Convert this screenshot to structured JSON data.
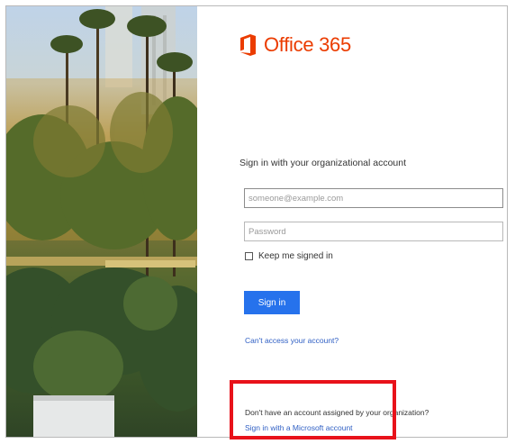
{
  "brand": {
    "name": "Office 365",
    "icon": "office-logo-icon",
    "color": "#eb3c00"
  },
  "login": {
    "heading": "Sign in with your organizational account",
    "username_placeholder": "someone@example.com",
    "password_placeholder": "Password",
    "keep_signed_in_label": "Keep me signed in",
    "keep_signed_in_checked": false,
    "sign_in_label": "Sign in",
    "cant_access_label": "Can't access your account?",
    "no_account_text": "Don't have an account assigned by your organization?",
    "microsoft_account_link": "Sign in with a Microsoft account"
  },
  "colors": {
    "accent": "#2672ec",
    "link": "#2f5fc4",
    "highlight": "#e8121a"
  }
}
